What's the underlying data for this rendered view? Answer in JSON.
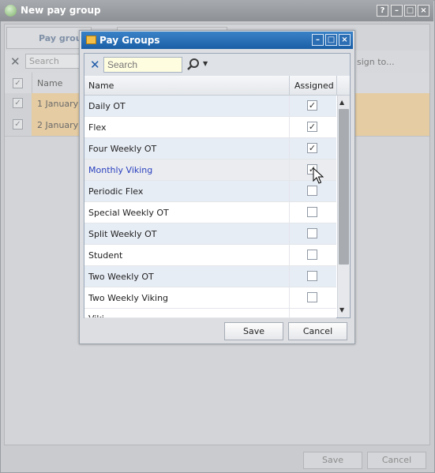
{
  "outer": {
    "title": "New pay group",
    "tab1": "Pay group",
    "search_placeholder": "Search",
    "assign_to": "sign to...",
    "col_name": "Name",
    "rows": [
      "1 January (",
      "2 January ("
    ],
    "save_label": "Save",
    "cancel_label": "Cancel",
    "window_buttons": [
      "?",
      "–",
      "□",
      "×"
    ]
  },
  "dialog": {
    "title": "Pay Groups",
    "search_placeholder": "Search",
    "col_name": "Name",
    "col_assigned": "Assigned",
    "rows": [
      {
        "name": "Daily OT",
        "assigned": true
      },
      {
        "name": "Flex",
        "assigned": true
      },
      {
        "name": "Four Weekly OT",
        "assigned": true
      },
      {
        "name": "Monthly Viking",
        "assigned": true
      },
      {
        "name": "Periodic Flex",
        "assigned": false
      },
      {
        "name": "Special Weekly OT",
        "assigned": false
      },
      {
        "name": "Split Weekly OT",
        "assigned": false
      },
      {
        "name": "Student",
        "assigned": false
      },
      {
        "name": "Two Weekly OT",
        "assigned": false
      },
      {
        "name": "Two Weekly Viking",
        "assigned": false
      }
    ],
    "highlighted_row": 3,
    "save_label": "Save",
    "cancel_label": "Cancel",
    "window_buttons": [
      "–",
      "□",
      "×"
    ],
    "colors": {
      "title_bar": "#1a5fa7",
      "row_alt": "#e7edf5",
      "highlight_text": "#2a3fbf",
      "hover_row": "#eaecef"
    }
  },
  "icons": {
    "outer_app": "green-leaf-icon",
    "dialog_app": "folder-icon",
    "clear": "clear-x-icon",
    "search": "magnifier-icon",
    "checkbox_checked": "check-mark-icon"
  }
}
